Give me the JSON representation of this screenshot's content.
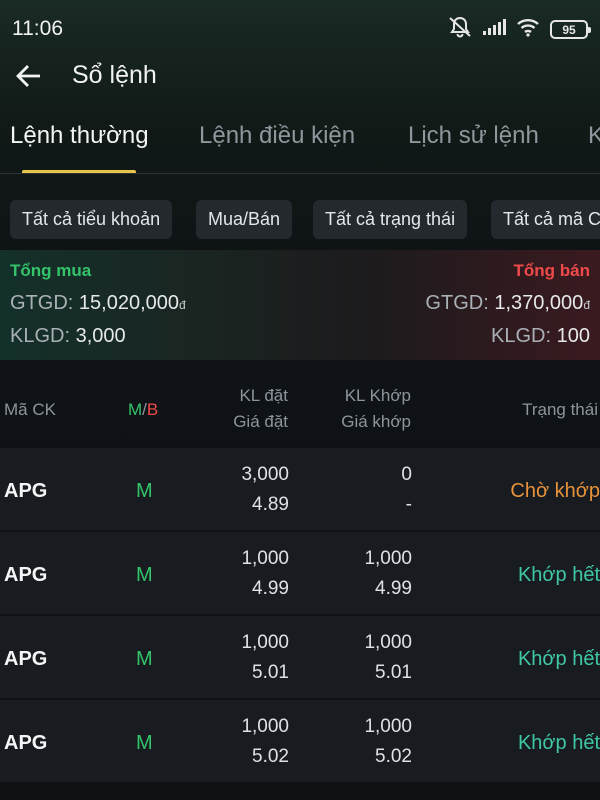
{
  "status_bar": {
    "time": "11:06",
    "battery": "95"
  },
  "header": {
    "title": "Sổ lệnh",
    "back_icon": "arrow-left-icon"
  },
  "tabs": [
    {
      "label": "Lệnh thường",
      "active": true
    },
    {
      "label": "Lệnh điều kiện",
      "active": false
    },
    {
      "label": "Lịch sử lệnh",
      "active": false
    },
    {
      "label": "K",
      "active": false
    }
  ],
  "filters": [
    {
      "label": "Tất cả tiểu khoản"
    },
    {
      "label": "Mua/Bán"
    },
    {
      "label": "Tất cả trạng thái"
    },
    {
      "label": "Tất cả mã C"
    }
  ],
  "summary": {
    "buy": {
      "title": "Tổng mua",
      "gtgd_label": "GTGD:",
      "gtgd_value": "15,020,000",
      "klgd_label": "KLGD:",
      "klgd_value": "3,000",
      "color": "#33c46b"
    },
    "sell": {
      "title": "Tổng bán",
      "gtgd_label": "GTGD:",
      "gtgd_value": "1,370,000",
      "klgd_label": "KLGD:",
      "klgd_value": "100",
      "color": "#ef4a4a"
    },
    "currency": "đ"
  },
  "table": {
    "headers": {
      "code": "Mã CK",
      "side_m": "M",
      "side_slash": "/",
      "side_b": "B",
      "qty_order": "KL đặt",
      "price_order": "Giá đặt",
      "qty_match": "KL Khớp",
      "price_match": "Giá khớp",
      "status": "Trạng thái"
    },
    "rows": [
      {
        "code": "APG",
        "side": "M",
        "qty_order": "3,000",
        "price_order": "4.89",
        "qty_match": "0",
        "price_match": "-",
        "status": "Chờ khớp",
        "status_color": "#e8913a"
      },
      {
        "code": "APG",
        "side": "M",
        "qty_order": "1,000",
        "price_order": "4.99",
        "qty_match": "1,000",
        "price_match": "4.99",
        "status": "Khớp hết",
        "status_color": "#3fc7a6"
      },
      {
        "code": "APG",
        "side": "M",
        "qty_order": "1,000",
        "price_order": "5.01",
        "qty_match": "1,000",
        "price_match": "5.01",
        "status": "Khớp hết",
        "status_color": "#3fc7a6"
      },
      {
        "code": "APG",
        "side": "M",
        "qty_order": "1,000",
        "price_order": "5.02",
        "qty_match": "1,000",
        "price_match": "5.02",
        "status": "Khớp hết",
        "status_color": "#3fc7a6"
      }
    ]
  }
}
